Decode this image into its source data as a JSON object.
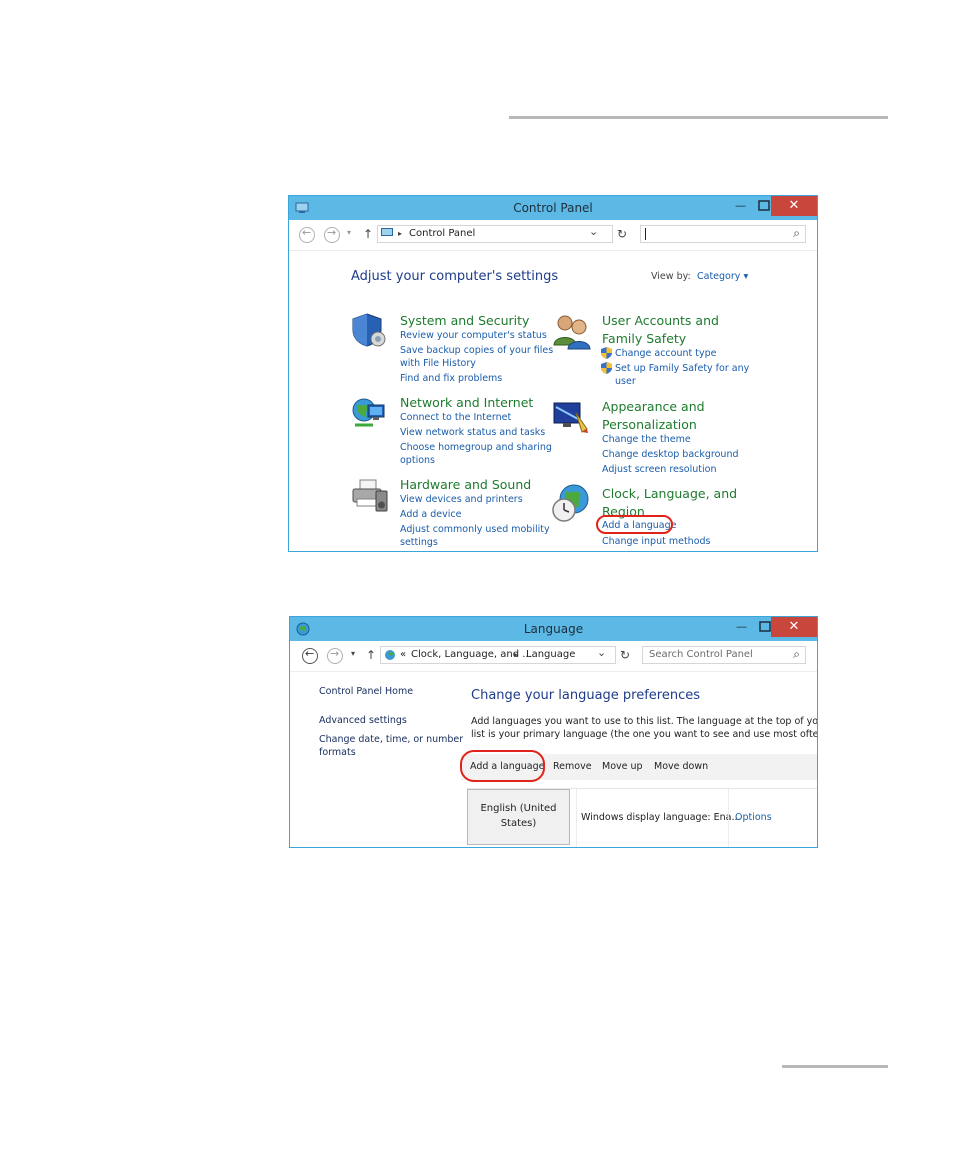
{
  "cp": {
    "title": "Control Panel",
    "address": "Control Panel",
    "search_placeholder": "",
    "heading": "Adjust your computer's settings",
    "view_by_label": "View by:",
    "view_by_value": "Category",
    "categories": [
      {
        "title": "System and Security",
        "links": [
          "Review your computer's status",
          "Save backup copies of your files",
          "with File History",
          "Find and fix problems"
        ]
      },
      {
        "title": "Network and Internet",
        "links": [
          "Connect to the Internet",
          "View network status and tasks",
          "Choose homegroup and sharing",
          "options"
        ]
      },
      {
        "title": "Hardware and Sound",
        "links": [
          "View devices and printers",
          "Add a device",
          "Adjust commonly used mobility",
          "settings"
        ]
      },
      {
        "title_lines": [
          "User Accounts and",
          "Family Safety"
        ],
        "links": [
          "Change account type",
          "Set up Family Safety for any",
          "user"
        ]
      },
      {
        "title_lines": [
          "Appearance and",
          "Personalization"
        ],
        "links": [
          "Change the theme",
          "Change desktop background",
          "Adjust screen resolution"
        ]
      },
      {
        "title_lines": [
          "Clock, Language, and",
          "Region"
        ],
        "links": [
          "Add a language",
          "Change input methods"
        ]
      }
    ]
  },
  "lang": {
    "title": "Language",
    "address_prefix": "«",
    "address_part1": "Clock, Language, and ...",
    "address_part2": "Language",
    "search_placeholder": "Search Control Panel",
    "sidebar": [
      "Control Panel Home",
      "Advanced settings",
      "Change date, time, or number",
      "formats"
    ],
    "heading": "Change your language preferences",
    "desc_line1": "Add languages you want to use to this list. The language at the top of your",
    "desc_line2": "list is your primary language (the one you want to see and use most often).",
    "toolbar": [
      "Add a language",
      "Remove",
      "Move up",
      "Move down"
    ],
    "language_line1": "English (United",
    "language_line2": "States)",
    "display_language": "Windows display language: Ena...",
    "options": "Options"
  },
  "glyphs": {
    "minimize": "—",
    "close": "✕",
    "up": "↑",
    "refresh": "↻",
    "search": "⌕",
    "dropdown": "⌄",
    "chevron": "▸",
    "caret": "▾"
  },
  "colors": {
    "titlebar": "#5cb8e4",
    "close": "#c8463c",
    "link": "#1a5dab",
    "category": "#1e7b2e",
    "highlight": "#e2231a"
  }
}
